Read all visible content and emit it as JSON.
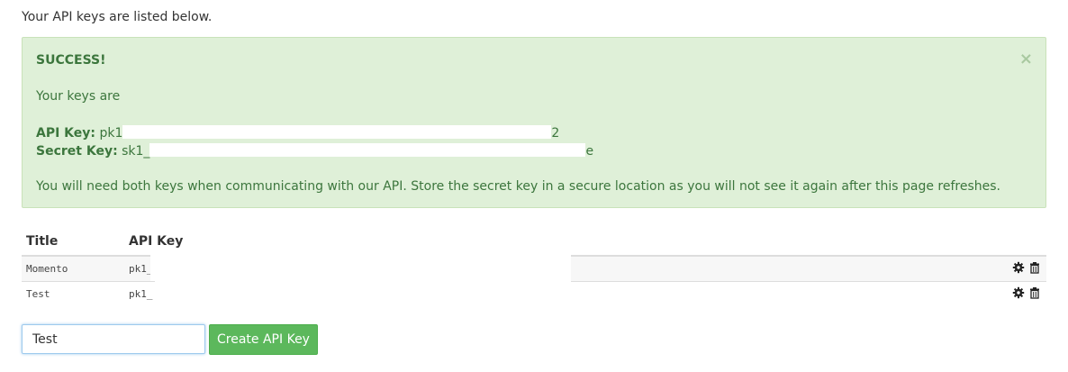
{
  "intro_text": "Your API keys are listed below.",
  "alert": {
    "title": "SUCCESS!",
    "close_symbol": "×",
    "keys_intro": "Your keys are",
    "api_key_label": "API Key:",
    "api_key_prefix": "pk1",
    "api_key_suffix": "2",
    "secret_key_label": "Secret Key:",
    "secret_key_prefix": "sk1_",
    "secret_key_suffix": "e",
    "notice": "You will need both keys when communicating with our API. Store the secret key in a secure location as you will not see it again after this page refreshes."
  },
  "table": {
    "headers": {
      "title": "Title",
      "api_key": "API Key"
    },
    "rows": [
      {
        "title": "Momento",
        "api_key": "pk1_"
      },
      {
        "title": "Test",
        "api_key": "pk1_"
      }
    ]
  },
  "form": {
    "title_value": "Test",
    "create_label": "Create API Key"
  },
  "colors": {
    "alert_bg": "#dff0d8",
    "alert_text": "#3c763d",
    "button_bg": "#5cb85c"
  },
  "icons": {
    "settings": "gear-icon",
    "delete": "trash-icon",
    "close": "close-icon"
  }
}
